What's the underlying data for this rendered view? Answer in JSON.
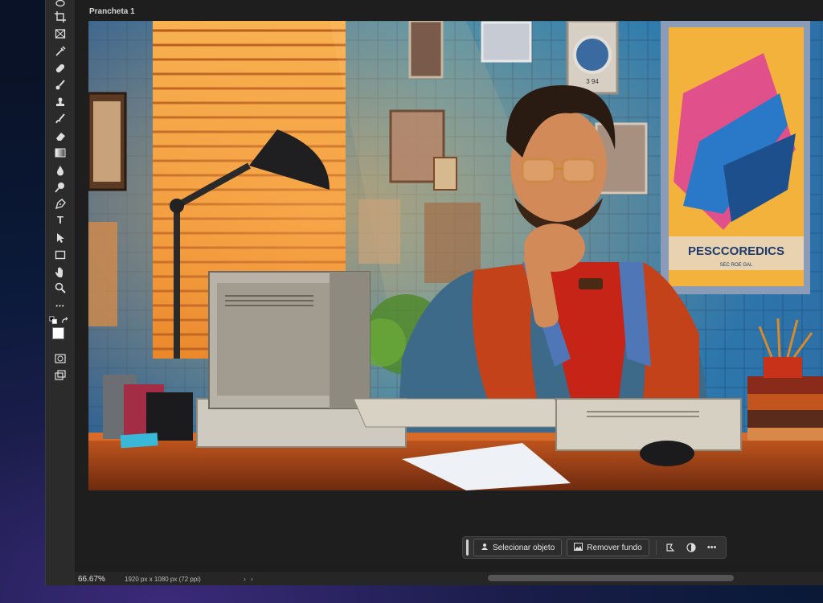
{
  "document": {
    "artboard_name": "Prancheta 1",
    "zoom": "66.67%",
    "info": "1920 px x 1080 px (72 ppi)"
  },
  "tools": [
    {
      "name": "lasso-icon"
    },
    {
      "name": "crop-icon"
    },
    {
      "name": "frame-icon"
    },
    {
      "name": "eyedropper-icon"
    },
    {
      "name": "healing-brush-icon"
    },
    {
      "name": "brush-icon"
    },
    {
      "name": "clone-stamp-icon"
    },
    {
      "name": "history-brush-icon"
    },
    {
      "name": "eraser-icon"
    },
    {
      "name": "gradient-icon"
    },
    {
      "name": "blur-icon"
    },
    {
      "name": "dodge-icon"
    },
    {
      "name": "pen-icon"
    },
    {
      "name": "type-icon",
      "label": "T"
    },
    {
      "name": "path-selection-icon"
    },
    {
      "name": "rectangle-icon"
    },
    {
      "name": "hand-icon"
    },
    {
      "name": "zoom-icon"
    },
    {
      "name": "more-tools-icon",
      "label": "•••"
    }
  ],
  "contextual_taskbar": {
    "select_subject": "Selecionar objeto",
    "remove_background": "Remover fundo",
    "more": "•••"
  },
  "image_text": {
    "poster": "PESCCOREDICS",
    "poster_sub": "SEC ROE GAL",
    "clock_caption": "3 94"
  },
  "colors": {
    "foreground": "#ffffff",
    "background": "#000000"
  }
}
